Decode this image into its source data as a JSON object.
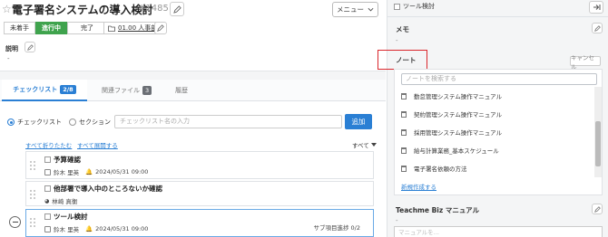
{
  "header": {
    "star_icon": "☆",
    "title": "電子署名システムの導入検討",
    "task_id": "#1485",
    "menu_label": "メニュー"
  },
  "status": {
    "options": [
      "未着手",
      "進行中",
      "完了"
    ],
    "active": "進行中",
    "due_date": "01.00 人事部"
  },
  "description": {
    "label": "説明",
    "value": "-"
  },
  "tabs": [
    {
      "label": "チェックリスト",
      "count": "2/8"
    },
    {
      "label": "関連ファイル",
      "count": "3"
    },
    {
      "label": "履歴",
      "count": ""
    }
  ],
  "add_row": {
    "option_checklist": "チェックリスト",
    "option_section": "セクション",
    "placeholder": "チェックリスト名の入力",
    "add_button": "追加"
  },
  "controls": {
    "collapse_all": "すべて折りたたむ",
    "expand_all": "すべて展開する",
    "filter": "すべて"
  },
  "checklist": [
    {
      "title": "予算確認",
      "assignee": "鈴木 里英",
      "date": "2024/05/31 09:00",
      "extra": ""
    },
    {
      "title": "他部署で導入中のところないか確認",
      "assignee": "林崎 真衡",
      "date": "",
      "extra": ""
    },
    {
      "title": "ツール検討",
      "assignee": "鈴木 里英",
      "date": "2024/05/31 09:00",
      "extra": "サブ項目進捗 0/2"
    }
  ],
  "right": {
    "tool_label": "ツール検討",
    "memo_label": "メモ",
    "memo_value": "-",
    "note_label": "ノート",
    "cancel_label": "キャンセル",
    "note_search_placeholder": "ノートを検索する",
    "notes": [
      "勤怠管理システム操作マニュアル",
      "契約管理システム操作マニュアル",
      "採用管理システム操作マニュアル",
      "給与計算業務_基本スケジュール",
      "電子署名依頼の方法"
    ],
    "new_note": "新規作成する",
    "manual_label": "Teachme Biz マニュアル",
    "manual_value": "-",
    "bottom_placeholder": "マニュアルを..."
  },
  "colors": {
    "accent": "#2a7fd4",
    "status_active": "#3fa34d",
    "highlight_frame": "#d9262c"
  }
}
